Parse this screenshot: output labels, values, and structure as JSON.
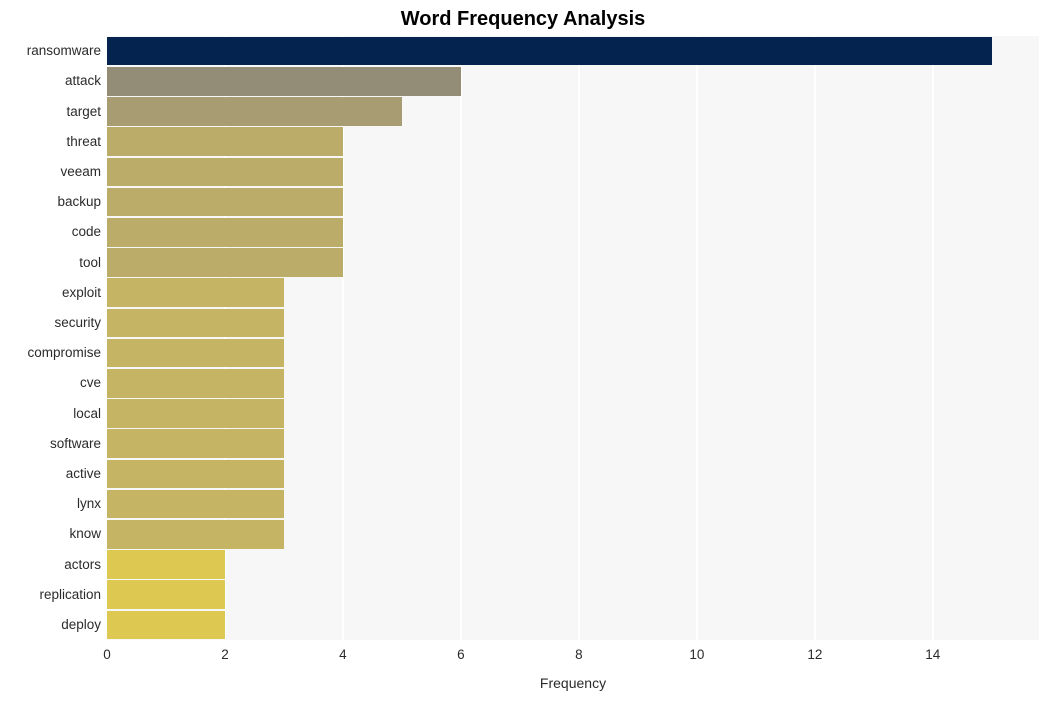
{
  "chart_data": {
    "type": "bar",
    "orientation": "horizontal",
    "title": "Word Frequency Analysis",
    "xlabel": "Frequency",
    "ylabel": "",
    "xlim": [
      0,
      15.8
    ],
    "ylim": [
      0,
      20
    ],
    "grid": true,
    "legend": false,
    "xticks": [
      0,
      2,
      4,
      6,
      8,
      10,
      12,
      14
    ],
    "xtick_labels": [
      "0",
      "2",
      "4",
      "6",
      "8",
      "10",
      "12",
      "14"
    ],
    "categories": [
      "ransomware",
      "attack",
      "target",
      "threat",
      "veeam",
      "backup",
      "code",
      "tool",
      "exploit",
      "security",
      "compromise",
      "cve",
      "local",
      "software",
      "active",
      "lynx",
      "know",
      "actors",
      "replication",
      "deploy"
    ],
    "values": [
      15,
      6,
      5,
      4,
      4,
      4,
      4,
      4,
      3,
      3,
      3,
      3,
      3,
      3,
      3,
      3,
      3,
      2,
      2,
      2
    ],
    "bar_colors": [
      "#04234f",
      "#938d78",
      "#a89d72",
      "#bbad69",
      "#bbad69",
      "#bbad69",
      "#bbad69",
      "#bbad69",
      "#c4b464",
      "#c4b464",
      "#c4b464",
      "#c4b464",
      "#c4b464",
      "#c4b464",
      "#c4b464",
      "#c4b464",
      "#c4b464",
      "#ddc852",
      "#ddc852",
      "#ddc852"
    ],
    "plot_background": "#f7f7f7",
    "gridline_color": "#ffffff",
    "title_color": "#000000",
    "tick_color": "#2b2b2b"
  }
}
